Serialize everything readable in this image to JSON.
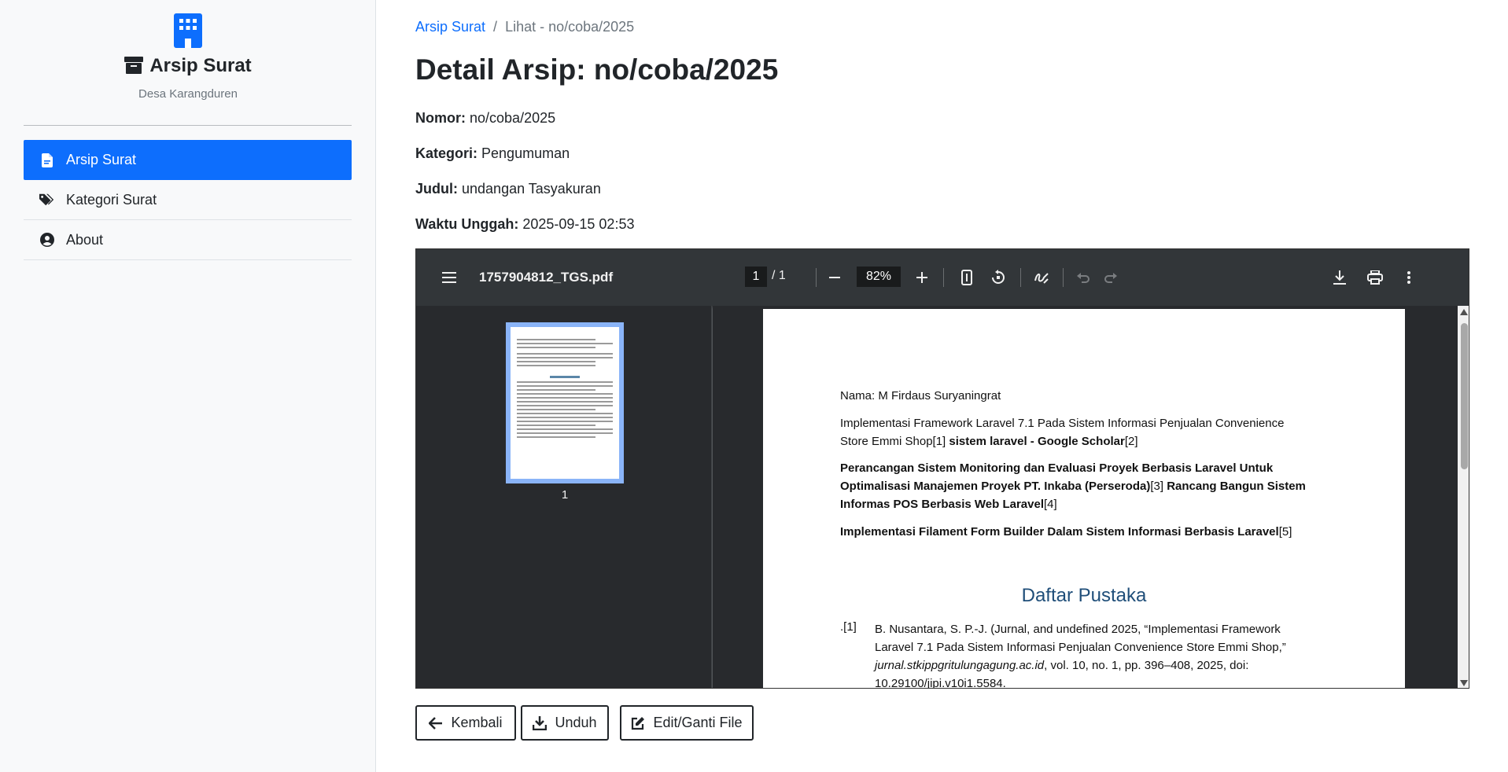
{
  "sidebar": {
    "brand_title": "Arsip Surat",
    "brand_subtitle": "Desa Karangduren",
    "items": [
      {
        "label": "Arsip Surat",
        "icon": "file-icon",
        "active": true
      },
      {
        "label": "Kategori Surat",
        "icon": "tags-icon",
        "active": false
      },
      {
        "label": "About",
        "icon": "user-circle-icon",
        "active": false
      }
    ]
  },
  "breadcrumb": {
    "root": "Arsip Surat",
    "separator": "/",
    "current": "Lihat - no/coba/2025"
  },
  "page_title": "Detail Arsip: no/coba/2025",
  "details": {
    "nomor_label": "Nomor:",
    "nomor": "no/coba/2025",
    "kategori_label": "Kategori:",
    "kategori": "Pengumuman",
    "judul_label": "Judul:",
    "judul": "undangan Tasyakuran",
    "waktu_label": "Waktu Unggah:",
    "waktu": "2025-09-15 02:53"
  },
  "viewer": {
    "file_name": "1757904812_TGS.pdf",
    "page_current": "1",
    "page_sep_total": "/ 1",
    "zoom": "82%",
    "thumbnail_label": "1",
    "page": {
      "line1": "Nama: M Firdaus Suryaningrat",
      "line2a": "Implementasi Framework Laravel 7.1 Pada Sistem Informasi Penjualan Convenience",
      "line2b_plain": "Store Emmi Shop[1] ",
      "line2b_bold": "sistem laravel - Google Scholar",
      "line2b_end": "[2]",
      "line3a": "Perancangan Sistem Monitoring dan Evaluasi Proyek Berbasis Laravel Untuk",
      "line3b_bold": "Optimalisasi Manajemen Proyek PT. Inkaba (Perseroda)",
      "line3b_plain": "[3] ",
      "line3b_bold2": "Rancang Bangun Sistem",
      "line3c_bold": "Informas POS Berbasis Web Laravel",
      "line3c_plain": "[4]",
      "line4_bold": "Implementasi Filament Form Builder Dalam Sistem Informasi Berbasis Laravel",
      "line4_plain": "[5]",
      "heading": "Daftar Pustaka",
      "ref1_num": ".[1]",
      "ref1_a": "B. Nusantara, S. P.-J. (Jurnal, and undefined 2025, “Implementasi Framework",
      "ref1_b": "Laravel 7.1 Pada Sistem Informasi Penjualan Convenience Store Emmi Shop,”",
      "ref1_c_italic": "jurnal.stkippgritulungagung.ac.id",
      "ref1_c_plain": ", vol. 10, no. 1, pp. 396–408, 2025, doi:",
      "ref1_d": "10.29100/jipi.v10i1.5584."
    }
  },
  "buttons": {
    "back": "Kembali",
    "download": "Unduh",
    "edit": "Edit/Ganti File"
  },
  "colors": {
    "primary": "#0d6efd",
    "sidebar_bg": "#f8f9fa",
    "pdf_toolbar": "#323639",
    "pdf_bg": "#282a2d"
  }
}
